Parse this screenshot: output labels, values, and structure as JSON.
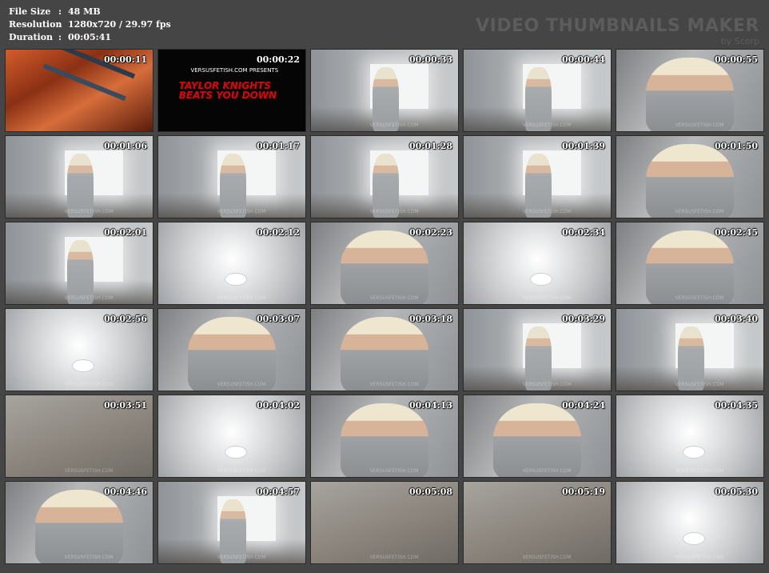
{
  "info": {
    "file_size_label": "File Size",
    "file_size_value": "48 MB",
    "resolution_label": "Resolution",
    "resolution_value": "1280x720 / 29.97 fps",
    "duration_label": "Duration",
    "duration_value": "00:05:41",
    "separator": ":"
  },
  "brand": {
    "title": "VIDEO THUMBNAILS MAKER",
    "byline": "by Scorp"
  },
  "title_card": {
    "line1": "VERSUSFETISH.COM PRESENTS",
    "line2": "TAYLOR KNIGHTS",
    "line3": "BEATS YOU DOWN"
  },
  "watermark": "VERSUSFETISH.COM",
  "thumbnails": [
    {
      "time": "00:00:11",
      "scene": "intro"
    },
    {
      "time": "00:00:22",
      "scene": "title"
    },
    {
      "time": "00:00:33",
      "scene": "room"
    },
    {
      "time": "00:00:44",
      "scene": "room"
    },
    {
      "time": "00:00:55",
      "scene": "close"
    },
    {
      "time": "00:01:06",
      "scene": "room"
    },
    {
      "time": "00:01:17",
      "scene": "room"
    },
    {
      "time": "00:01:28",
      "scene": "room"
    },
    {
      "time": "00:01:39",
      "scene": "room"
    },
    {
      "time": "00:01:50",
      "scene": "close"
    },
    {
      "time": "00:02:01",
      "scene": "room"
    },
    {
      "time": "00:02:12",
      "scene": "ceiling"
    },
    {
      "time": "00:02:23",
      "scene": "close"
    },
    {
      "time": "00:02:34",
      "scene": "ceiling"
    },
    {
      "time": "00:02:45",
      "scene": "close"
    },
    {
      "time": "00:02:56",
      "scene": "ceiling"
    },
    {
      "time": "00:03:07",
      "scene": "close"
    },
    {
      "time": "00:03:18",
      "scene": "close"
    },
    {
      "time": "00:03:29",
      "scene": "room"
    },
    {
      "time": "00:03:40",
      "scene": "room"
    },
    {
      "time": "00:03:51",
      "scene": "floor"
    },
    {
      "time": "00:04:02",
      "scene": "ceiling"
    },
    {
      "time": "00:04:13",
      "scene": "close"
    },
    {
      "time": "00:04:24",
      "scene": "close"
    },
    {
      "time": "00:04:35",
      "scene": "ceiling"
    },
    {
      "time": "00:04:46",
      "scene": "close"
    },
    {
      "time": "00:04:57",
      "scene": "room"
    },
    {
      "time": "00:05:08",
      "scene": "floor"
    },
    {
      "time": "00:05:19",
      "scene": "floor"
    },
    {
      "time": "00:05:30",
      "scene": "ceiling"
    }
  ]
}
